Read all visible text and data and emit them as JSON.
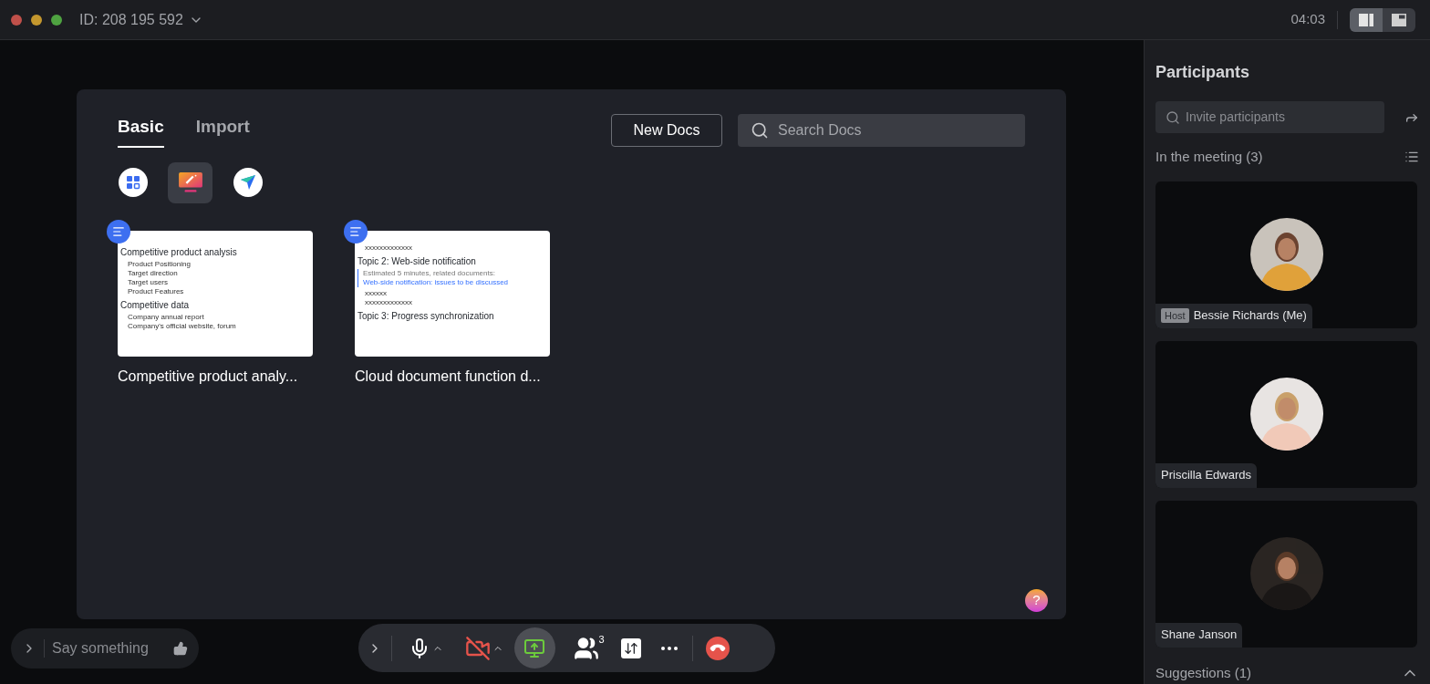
{
  "title_bar": {
    "meeting_id": "ID: 208 195 592",
    "timer": "04:03",
    "layout_buttons": [
      {
        "kind": "split",
        "selected": true
      },
      {
        "kind": "pip",
        "selected": false
      }
    ]
  },
  "docs": {
    "tabs": [
      {
        "label": "Basic",
        "selected": true
      },
      {
        "label": "Import",
        "selected": false
      }
    ],
    "new_button": "New Docs",
    "search": {
      "placeholder": "Search Docs"
    },
    "apps": [
      {
        "kind": "grid",
        "selected": false
      },
      {
        "kind": "slides",
        "selected": true
      },
      {
        "kind": "plane",
        "selected": false
      }
    ],
    "documents": [
      {
        "title": "Competitive product analy...",
        "preview": [
          {
            "kind": "heading",
            "text": "Competitive product analysis"
          },
          {
            "kind": "bullet",
            "text": "Product Positioning"
          },
          {
            "kind": "bullet",
            "text": "Target direction"
          },
          {
            "kind": "bullet",
            "text": "Target users"
          },
          {
            "kind": "bullet",
            "text": "Product Features"
          },
          {
            "kind": "heading",
            "text": "Competitive data"
          },
          {
            "kind": "bullet",
            "text": "Company annual report"
          },
          {
            "kind": "bullet",
            "text": "Company's official website, forum"
          }
        ]
      },
      {
        "title": "Cloud document function d...",
        "preview": [
          {
            "kind": "plain",
            "text": "xxxxxxxxxxxxx"
          },
          {
            "kind": "heading",
            "text": "Topic 2: Web-side notification"
          },
          {
            "kind": "note",
            "text": "Estimated 5 minutes, related documents: ",
            "link": "Web-side notification: issues to be discussed"
          },
          {
            "kind": "bullet",
            "text": "xxxxxx"
          },
          {
            "kind": "bullet",
            "text": "xxxxxxxxxxxxx"
          },
          {
            "kind": "heading",
            "text": "Topic 3: Progress synchronization"
          }
        ]
      }
    ],
    "help": "?"
  },
  "chat": {
    "placeholder": "Say something"
  },
  "toolbar": {
    "mic_muted": false,
    "camera_off": true,
    "sharing": true,
    "participant_count": "3"
  },
  "participants": {
    "title": "Participants",
    "invite": {
      "placeholder": "Invite participants"
    },
    "in_meeting": "In the meeting (3)",
    "members": [
      {
        "name": "Bessie Richards (Me)",
        "host": "Host",
        "kind": "orange"
      },
      {
        "name": "Priscilla Edwards",
        "kind": "light"
      },
      {
        "name": "Shane Janson",
        "kind": "dark"
      }
    ],
    "suggestions": "Suggestions (1)",
    "suggestions_expanded": true
  }
}
